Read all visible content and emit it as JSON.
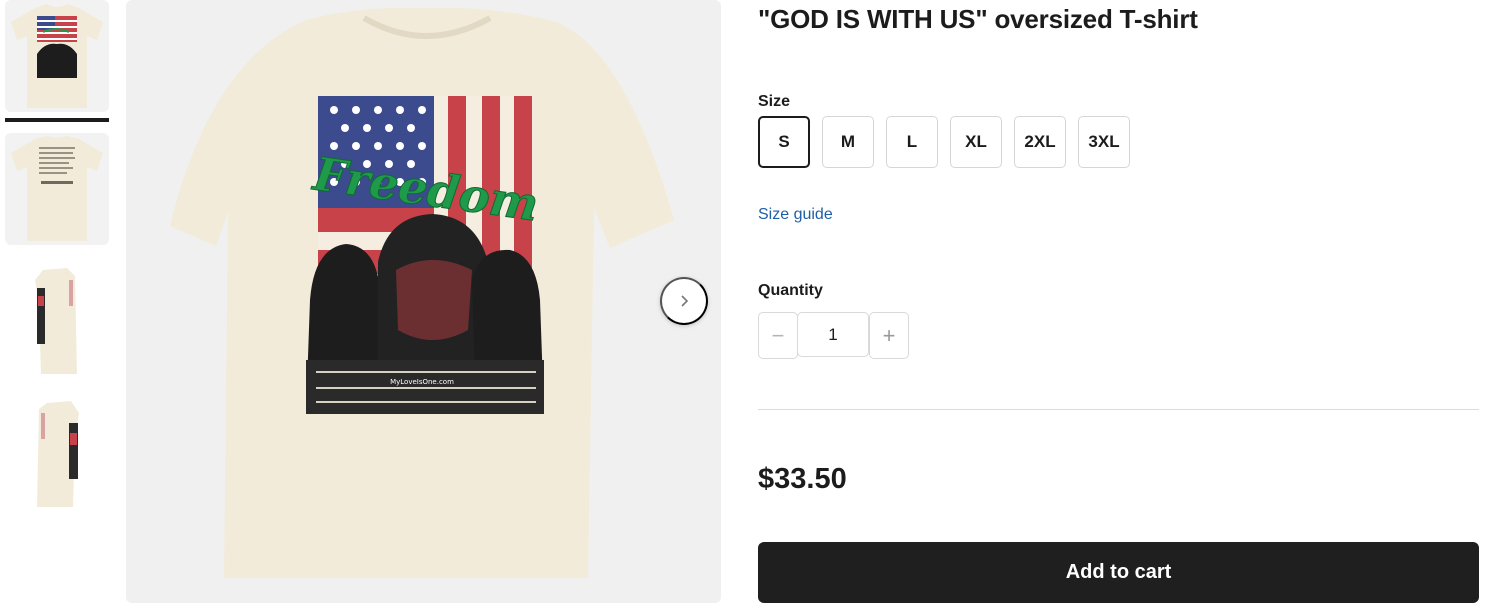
{
  "product": {
    "title": "\"GOD IS WITH US\" oversized T-shirt",
    "print_text": "Freedom",
    "watermark": "MyLoveIsOne.com"
  },
  "thumbnails": [
    {
      "alt": "front view"
    },
    {
      "alt": "back view"
    },
    {
      "alt": "left sleeve view"
    },
    {
      "alt": "right sleeve view"
    }
  ],
  "size": {
    "label": "Size",
    "options": [
      "S",
      "M",
      "L",
      "XL",
      "2XL",
      "3XL"
    ],
    "selected": "S"
  },
  "size_guide_label": "Size guide",
  "quantity": {
    "label": "Quantity",
    "value": "1",
    "decrement_symbol": "−",
    "increment_symbol": "+"
  },
  "price": "$33.50",
  "add_to_cart_label": "Add to cart",
  "colors": {
    "shirt": "#f2ebd9",
    "accent": "#1f1f1f",
    "link": "#1f5fa8",
    "flag_red": "#c8424a",
    "flag_blue": "#3c4a8e",
    "script_green": "#1f9a4a"
  }
}
